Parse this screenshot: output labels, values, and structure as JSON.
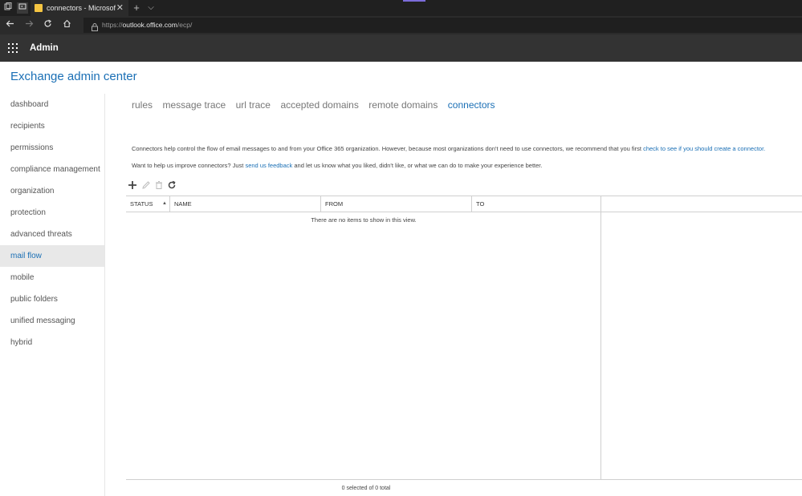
{
  "browser": {
    "tab_title": "connectors - Microsoft I",
    "tab_close": "✕",
    "new_tab": "+",
    "tab_dropdown": "⌵",
    "url_prefix": "https://",
    "url_host": "outlook.office.com",
    "url_path": "/ecp/"
  },
  "header": {
    "app_name": "Admin"
  },
  "page": {
    "title": "Exchange admin center"
  },
  "sidebar": {
    "items": [
      {
        "label": "dashboard",
        "active": false
      },
      {
        "label": "recipients",
        "active": false
      },
      {
        "label": "permissions",
        "active": false
      },
      {
        "label": "compliance management",
        "active": false
      },
      {
        "label": "organization",
        "active": false
      },
      {
        "label": "protection",
        "active": false
      },
      {
        "label": "advanced threats",
        "active": false
      },
      {
        "label": "mail flow",
        "active": true
      },
      {
        "label": "mobile",
        "active": false
      },
      {
        "label": "public folders",
        "active": false
      },
      {
        "label": "unified messaging",
        "active": false
      },
      {
        "label": "hybrid",
        "active": false
      }
    ]
  },
  "subtabs": [
    {
      "label": "rules",
      "active": false
    },
    {
      "label": "message trace",
      "active": false
    },
    {
      "label": "url trace",
      "active": false
    },
    {
      "label": "accepted domains",
      "active": false
    },
    {
      "label": "remote domains",
      "active": false
    },
    {
      "label": "connectors",
      "active": true
    }
  ],
  "info": {
    "line1_text": "Connectors help control the flow of email messages to and from your Office 365 organization. However, because most organizations don't need to use connectors, we recommend that you first ",
    "line1_link": "check to see if you should create a connector.",
    "line2_before": "Want to help us improve connectors? Just ",
    "line2_link": "send us feedback",
    "line2_after": " and let us know what you liked, didn't like, or what we can do to make your experience better."
  },
  "toolbar": {
    "icons": [
      "add-icon",
      "edit-icon",
      "delete-icon",
      "refresh-icon"
    ]
  },
  "grid": {
    "columns": [
      "STATUS",
      "NAME",
      "FROM",
      "TO"
    ],
    "sort_indicator": "▲",
    "empty_message": "There are no items to show in this view.",
    "footer": "0 selected of 0 total"
  },
  "colors": {
    "accent": "#1a6fb5",
    "header_bg": "#333333",
    "active_nav_bg": "#e8e8e8"
  }
}
